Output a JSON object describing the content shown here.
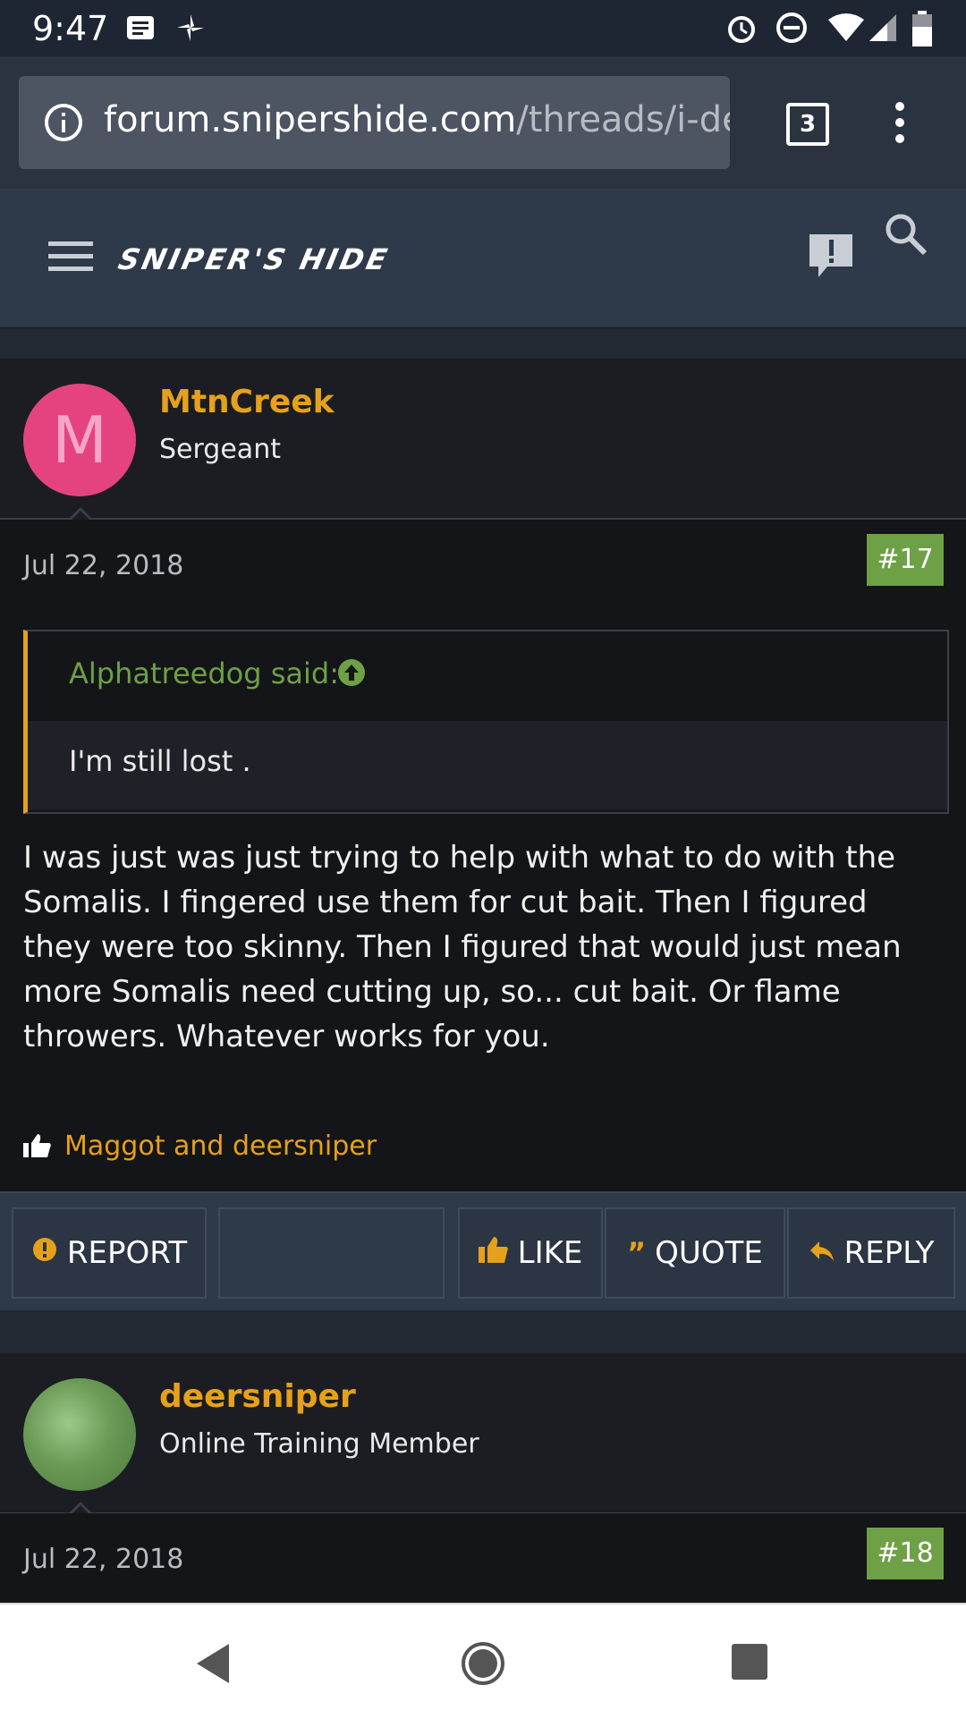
{
  "status_bar": {
    "time": "9:47",
    "icons": [
      "notification-icon",
      "fan-icon",
      "alarm-icon",
      "dnd-icon",
      "wifi-icon",
      "signal-icon",
      "battery-icon"
    ]
  },
  "browser": {
    "url_host": "forum.snipershide.com",
    "url_path": "/threads/i-de",
    "tab_count": "3"
  },
  "site": {
    "logo_text": "SNIPER'S HIDE"
  },
  "posts": [
    {
      "username": "MtnCreek",
      "user_title": "Sergeant",
      "avatar_letter": "M",
      "avatar_color": "#e5437f",
      "date": "Jul 22, 2018",
      "post_number": "#17",
      "quote": {
        "author": "Alphatreedog said:",
        "text": "I'm still lost ."
      },
      "message": "I was just was just trying to help with what to do with the Somalis. I fingered use them for cut bait. Then I figured they were too skinny. Then I figured that would just mean more Somalis need cutting up, so... cut bait. Or flame throwers. Whatever works for you.",
      "likes_text": "Maggot and deersniper"
    },
    {
      "username": "deersniper",
      "user_title": "Online Training Member",
      "avatar_color": "#6a9a55",
      "date": "Jul 22, 2018",
      "post_number": "#18"
    }
  ],
  "actions": {
    "report": "REPORT",
    "like": "LIKE",
    "quote": "QUOTE",
    "reply": "REPLY"
  },
  "colors": {
    "accent": "#e6a11a",
    "green": "#6ea046",
    "header_bg": "#2e3949"
  }
}
